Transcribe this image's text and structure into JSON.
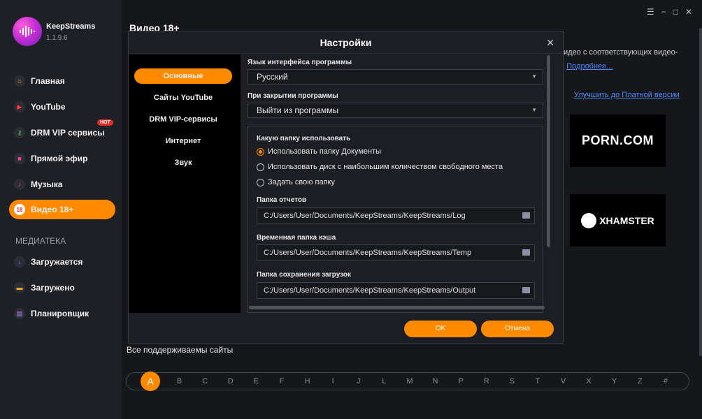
{
  "app": {
    "name": "KeepStreams",
    "version": "1.1.9.6"
  },
  "sidebar": {
    "items": [
      {
        "label": "Главная"
      },
      {
        "label": "YouTube"
      },
      {
        "label": "DRM VIP сервисы",
        "badge": "HOT"
      },
      {
        "label": "Прямой эфир"
      },
      {
        "label": "Музыка"
      },
      {
        "label": "Видео 18+"
      }
    ],
    "media_title": "МЕДИАТЕКА",
    "media_items": [
      {
        "label": "Загружается"
      },
      {
        "label": "Загружено"
      },
      {
        "label": "Планировщик"
      }
    ]
  },
  "main": {
    "title": "Видео 18+",
    "desc_line1": "идео с соответствующих видео-",
    "desc_line2_prefix": "е.",
    "desc_link": "Подробнее...",
    "upgrade_link": "Улучшить до Платной версии",
    "sites": [
      "PORN.COM",
      "XHAMSTER"
    ],
    "supported_label": "Все поддерживаемы сайты",
    "alphabet": [
      "A",
      "B",
      "C",
      "D",
      "E",
      "F",
      "H",
      "I",
      "J",
      "L",
      "M",
      "N",
      "P",
      "R",
      "S",
      "T",
      "V",
      "X",
      "Y",
      "Z",
      "#"
    ]
  },
  "dialog": {
    "title": "Настройки",
    "nav": [
      "Основные",
      "Сайты YouTube",
      "DRM VIP-сервисы",
      "Интернет",
      "Звук"
    ],
    "lang_label": "Язык интерфейса программы",
    "lang_value": "Русский",
    "close_label": "При закрытии программы",
    "close_value": "Выйти из программы",
    "folder_label": "Какую папку использовать",
    "radio_options": [
      "Использовать папку Документы",
      "Использовать диск с наибольшим количеством свободного места",
      "Задать свою папку"
    ],
    "log_label": "Папка отчетов",
    "log_path": "C:/Users/User/Documents/KeepStreams/KeepStreams/Log",
    "temp_label": "Временная папка кэша",
    "temp_path": "C:/Users/User/Documents/KeepStreams/KeepStreams/Temp",
    "out_label": "Папка сохранения загрузок",
    "out_path": "C:/Users/User/Documents/KeepStreams/KeepStreams/Output",
    "ok": "OK",
    "cancel": "Отмена"
  },
  "colors": {
    "accent": "#ff8a00",
    "link": "#4c8cff",
    "hot": "#e12b2b"
  }
}
